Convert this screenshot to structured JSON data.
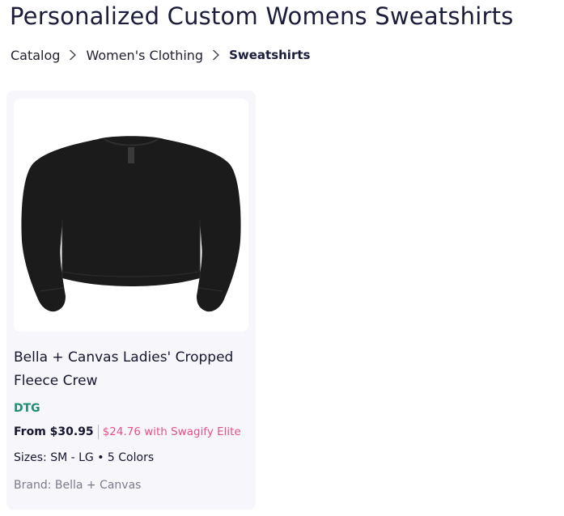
{
  "page": {
    "title": "Personalized Custom Womens Sweatshirts"
  },
  "breadcrumb": {
    "items": [
      {
        "label": "Catalog"
      },
      {
        "label": "Women's Clothing"
      },
      {
        "label": "Sweatshirts"
      }
    ],
    "separator_icon": "chevron-right-icon"
  },
  "products": [
    {
      "name": "Bella + Canvas Ladies' Cropped Fleece Crew",
      "image_icon": "black-cropped-sweatshirt-image",
      "method": "DTG",
      "from_price": "From $30.95",
      "elite_price": "$24.76 with Swagify Elite",
      "sizes_colors": "Sizes: SM - LG • 5 Colors",
      "brand": "Brand: Bella + Canvas"
    }
  ],
  "colors": {
    "title": "#1b1c3a",
    "card_background": "#f6f6fb",
    "method_badge": "#1e8d74",
    "elite_price": "#e6518a",
    "brand_text": "#7b7b8a",
    "garment": "#1a1a1a"
  }
}
